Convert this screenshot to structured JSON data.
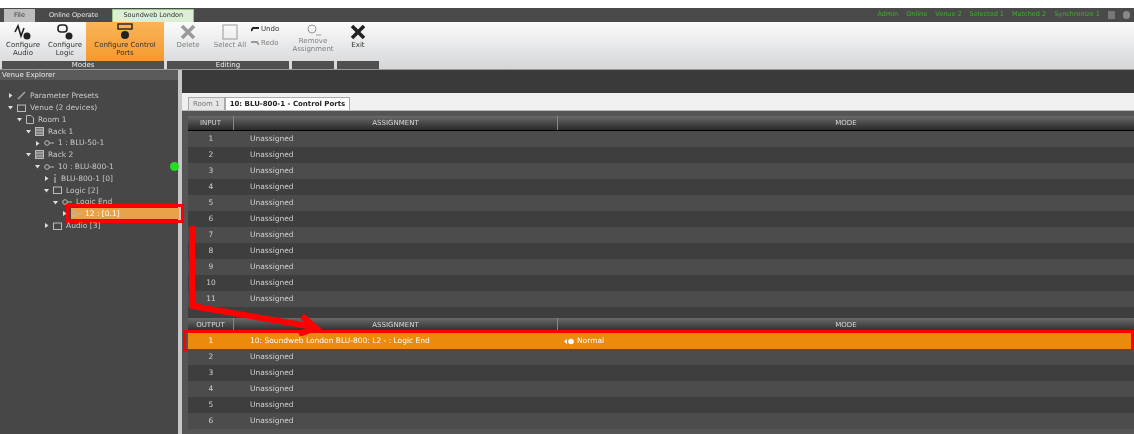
{
  "menu_tabs": [
    {
      "label": "File",
      "selected": false,
      "kind": "file"
    },
    {
      "label": "Online Operate",
      "selected": false,
      "kind": "tab"
    },
    {
      "label": "Soundweb London",
      "selected": true,
      "kind": "tab"
    }
  ],
  "status_items": [
    "Admin",
    "Online",
    "Venue 2",
    "Selected 1",
    "Matched 2",
    "Synchronize 1"
  ],
  "ribbon_groups": [
    {
      "label": "Modes",
      "buttons": [
        {
          "label": "Configure Audio",
          "kind": "wave",
          "selected": false,
          "disabled": false
        },
        {
          "label": "Configure Logic",
          "kind": "logic",
          "selected": false,
          "disabled": false
        },
        {
          "label": "Configure Control Ports",
          "kind": "ports",
          "selected": true,
          "disabled": false
        }
      ]
    },
    {
      "label": "Editing",
      "buttons": [
        {
          "label": "Delete",
          "kind": "x",
          "selected": false,
          "disabled": true
        },
        {
          "label": "Select All",
          "kind": "square",
          "selected": false,
          "disabled": true
        }
      ],
      "small_buttons": [
        {
          "label": "Undo",
          "kind": "undo",
          "disabled": false
        },
        {
          "label": "Redo",
          "kind": "redo",
          "disabled": true
        }
      ]
    },
    {
      "buttons": [
        {
          "label": "Remove Assignment",
          "kind": "remove",
          "selected": false,
          "disabled": true
        }
      ]
    },
    {
      "buttons": [
        {
          "label": "Exit",
          "kind": "x",
          "selected": false,
          "disabled": false
        }
      ]
    }
  ],
  "explorer": {
    "title": "Venue Explorer",
    "tree": [
      {
        "label": "Parameter Presets",
        "kind": "pencil",
        "expanded": false,
        "selected": false
      },
      {
        "label": "Venue (2 devices)",
        "kind": "folder",
        "expanded": true,
        "selected": false,
        "children": [
          {
            "label": "Room 1",
            "kind": "page",
            "expanded": true,
            "selected": false,
            "children": [
              {
                "label": "Rack 1",
                "kind": "rack",
                "expanded": true,
                "selected": false,
                "children": [
                  {
                    "label": "1 : BLU-50-1",
                    "kind": "device",
                    "expanded": false,
                    "selected": false
                  }
                ]
              },
              {
                "label": "Rack 2",
                "kind": "rack",
                "expanded": true,
                "selected": false,
                "children": [
                  {
                    "label": "10 : BLU-800-1",
                    "kind": "device",
                    "expanded": true,
                    "selected": false,
                    "color": "#22dd22",
                    "children": [
                      {
                        "label": "BLU-800-1 [0]",
                        "kind": "info",
                        "expanded": false,
                        "selected": false
                      },
                      {
                        "label": "Logic [2]",
                        "kind": "folder",
                        "expanded": true,
                        "selected": false,
                        "children": [
                          {
                            "label": "Logic End",
                            "kind": "device",
                            "expanded": true,
                            "selected": false,
                            "children": [
                              {
                                "label": "12 : [0.1]",
                                "kind": "device",
                                "expanded": false,
                                "selected": true
                              }
                            ]
                          }
                        ]
                      },
                      {
                        "label": "Audio [3]",
                        "kind": "folder",
                        "expanded": false,
                        "selected": false
                      }
                    ]
                  }
                ]
              }
            ]
          }
        ]
      }
    ]
  },
  "doc_tabs": [
    {
      "label": "Room 1",
      "selected": false
    },
    {
      "label": "10: BLU-800-1 - Control Ports",
      "selected": true
    }
  ],
  "inputs": {
    "columns": [
      "INPUT",
      "ASSIGNMENT",
      "MODE"
    ],
    "rows": [
      {
        "port": "1",
        "assignment": "Unassigned",
        "selected": false
      },
      {
        "port": "2",
        "assignment": "Unassigned",
        "selected": false
      },
      {
        "port": "3",
        "assignment": "Unassigned",
        "selected": false
      },
      {
        "port": "4",
        "assignment": "Unassigned",
        "selected": false
      },
      {
        "port": "5",
        "assignment": "Unassigned",
        "selected": false
      },
      {
        "port": "6",
        "assignment": "Unassigned",
        "selected": false
      },
      {
        "port": "7",
        "assignment": "Unassigned",
        "selected": false
      },
      {
        "port": "8",
        "assignment": "Unassigned",
        "selected": false
      },
      {
        "port": "9",
        "assignment": "Unassigned",
        "selected": false
      },
      {
        "port": "10",
        "assignment": "Unassigned",
        "selected": false
      },
      {
        "port": "11",
        "assignment": "Unassigned",
        "selected": false
      }
    ]
  },
  "outputs": {
    "columns": [
      "OUTPUT",
      "ASSIGNMENT",
      "MODE"
    ],
    "rows": [
      {
        "port": "1",
        "assignment": "10: Soundweb London BLU-800: L2 - : Logic End",
        "mode": "Normal",
        "selected": true
      },
      {
        "port": "2",
        "assignment": "Unassigned",
        "selected": false
      },
      {
        "port": "3",
        "assignment": "Unassigned",
        "selected": false
      },
      {
        "port": "4",
        "assignment": "Unassigned",
        "selected": false
      },
      {
        "port": "5",
        "assignment": "Unassigned",
        "selected": false
      },
      {
        "port": "6",
        "assignment": "Unassigned",
        "selected": false
      }
    ]
  }
}
